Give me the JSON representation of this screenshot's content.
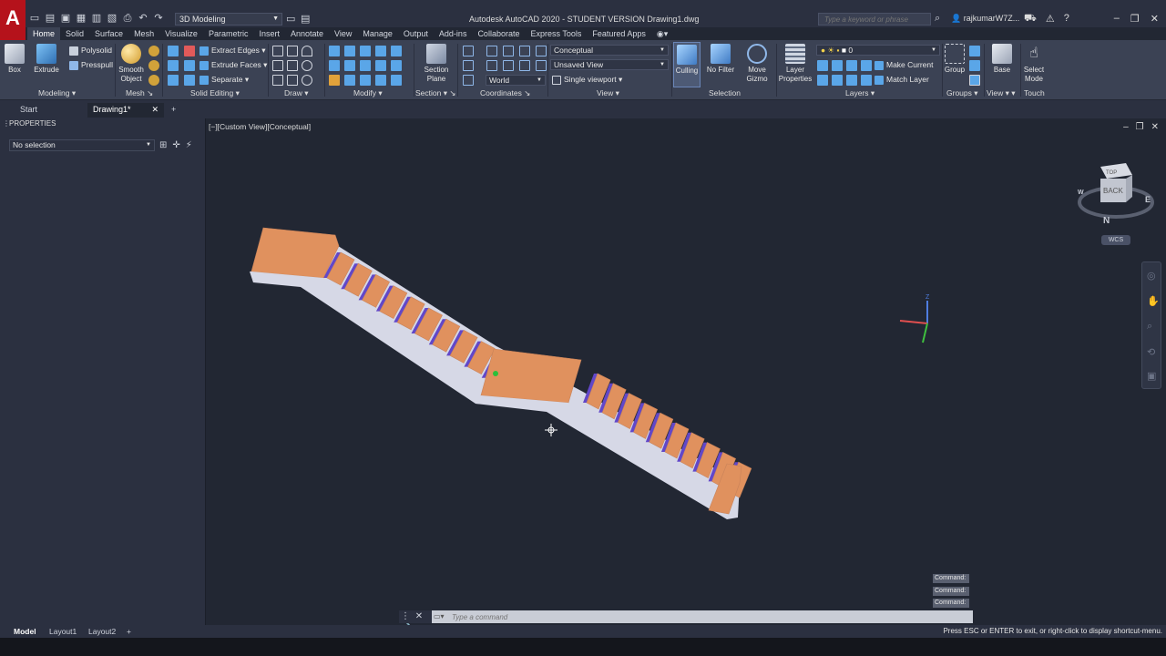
{
  "app": {
    "logo": "A",
    "title": "Autodesk AutoCAD 2020 - STUDENT VERSION   Drawing1.dwg",
    "workspace": "3D Modeling",
    "search_placeholder": "Type a keyword or phrase",
    "user": "rajkumarW7Z..."
  },
  "ribbon_tabs": [
    "Home",
    "Solid",
    "Surface",
    "Mesh",
    "Visualize",
    "Parametric",
    "Insert",
    "Annotate",
    "View",
    "Manage",
    "Output",
    "Add-ins",
    "Collaborate",
    "Express Tools",
    "Featured Apps"
  ],
  "ribbon": {
    "modeling": {
      "label": "Modeling",
      "box": "Box",
      "extrude": "Extrude",
      "polysolid": "Polysolid",
      "presspull": "Presspull"
    },
    "mesh": {
      "label": "Mesh",
      "smooth_object_1": "Smooth",
      "smooth_object_2": "Object"
    },
    "solid_editing": {
      "label": "Solid Editing",
      "extract_edges": "Extract Edges",
      "extrude_faces": "Extrude Faces",
      "separate": "Separate"
    },
    "draw": {
      "label": "Draw"
    },
    "modify": {
      "label": "Modify"
    },
    "section": {
      "label": "Section",
      "section_plane_1": "Section",
      "section_plane_2": "Plane"
    },
    "coordinates": {
      "label": "Coordinates",
      "world": "World"
    },
    "view": {
      "label": "View",
      "visual_style": "Conceptual",
      "saved_view": "Unsaved View",
      "viewport": "Single viewport"
    },
    "selection": {
      "label": "Selection",
      "culling": "Culling",
      "no_filter": "No Filter",
      "move_gizmo_1": "Move",
      "move_gizmo_2": "Gizmo"
    },
    "layers": {
      "label": "Layers",
      "layer_properties_1": "Layer",
      "layer_properties_2": "Properties",
      "current_layer": "0",
      "make_current": "Make Current",
      "match_layer": "Match Layer"
    },
    "groups": {
      "label": "Groups",
      "group": "Group"
    },
    "view2": {
      "label": "View",
      "base": "Base"
    },
    "touch": {
      "label": "Touch",
      "select_mode_1": "Select",
      "select_mode_2": "Mode"
    }
  },
  "doc_tabs": {
    "start": "Start",
    "drawing": "Drawing1*"
  },
  "palette": {
    "title": "PROPERTIES",
    "selection": "No selection"
  },
  "viewport": {
    "label": "[−][Custom View][Conceptual]",
    "viewcube_face": "BACK",
    "viewcube_top": "TOP",
    "compass_n": "N",
    "compass_e": "E",
    "compass_w": "W",
    "wcs": "WCS",
    "axis_z": "Z"
  },
  "command": {
    "history": [
      "Command:",
      "Command:",
      "Command:"
    ],
    "placeholder": "Type a command"
  },
  "layout_tabs": [
    "Model",
    "Layout1",
    "Layout2"
  ],
  "status_message": "Press ESC or ENTER to exit, or right-click to display shortcut-menu.",
  "colors": {
    "tread": "#e0915e",
    "riser": "#6247c8",
    "concrete": "#d6d8e6",
    "background": "#222733",
    "logo": "#b5121b"
  }
}
